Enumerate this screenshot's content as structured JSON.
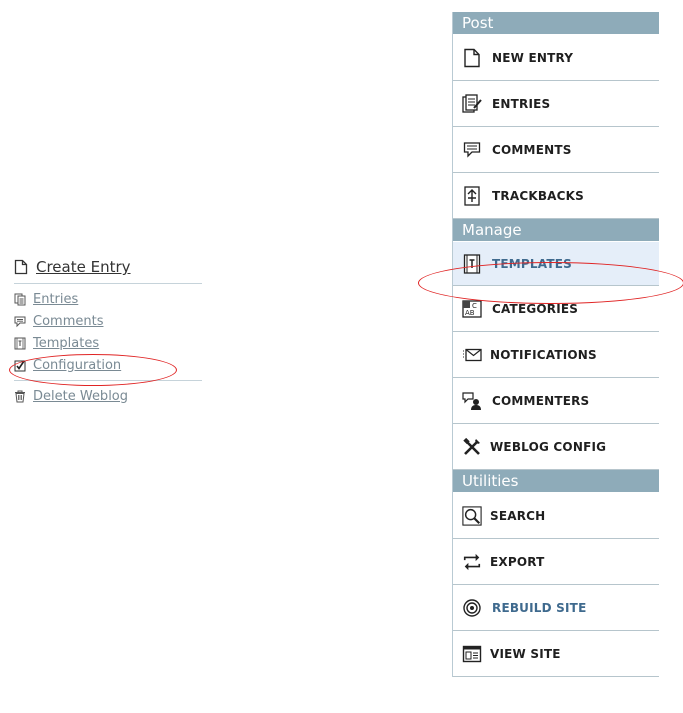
{
  "left_menu": {
    "create_entry": "Create Entry",
    "items": [
      {
        "label": "Entries",
        "icon": "entries-icon"
      },
      {
        "label": "Comments",
        "icon": "comment-icon"
      },
      {
        "label": "Templates",
        "icon": "template-icon"
      },
      {
        "label": "Configuration",
        "icon": "checkbox-icon"
      }
    ],
    "delete": "Delete Weblog"
  },
  "sidebar": {
    "sections": [
      {
        "title": "Post",
        "items": [
          "NEW ENTRY",
          "ENTRIES",
          "COMMENTS",
          "TRACKBACKS"
        ]
      },
      {
        "title": "Manage",
        "items": [
          "TEMPLATES",
          "CATEGORIES",
          "NOTIFICATIONS",
          "COMMENTERS",
          "WEBLOG CONFIG"
        ]
      },
      {
        "title": "Utilities",
        "items": [
          "SEARCH",
          "EXPORT",
          "REBUILD SITE",
          "VIEW SITE"
        ]
      }
    ]
  },
  "colors": {
    "section_header_bg": "#8eabb9",
    "active_item_bg": "#e5eef9",
    "annotation_red": "#e02424",
    "link_blue": "#3f6a8e"
  }
}
